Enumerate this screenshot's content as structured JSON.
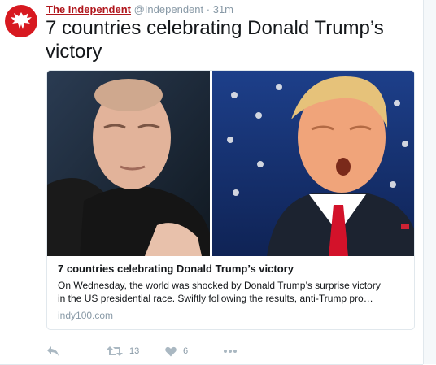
{
  "tweet": {
    "display_name": "The Independent",
    "handle": "@Independent",
    "separator": "·",
    "timestamp": "31m",
    "text": "7 countries celebrating Donald Trump’s victory"
  },
  "card": {
    "title": "7 countries celebrating Donald Trump’s victory",
    "description_line1": "On Wednesday, the world was shocked by Donald Trump’s surprise victory",
    "description_line2": "in the US presidential race. Swiftly following the results, anti-Trump pro…",
    "domain": "indy100.com"
  },
  "actions": {
    "reply_icon": "reply-icon",
    "retweet_icon": "retweet-icon",
    "retweet_count": "13",
    "like_icon": "heart-icon",
    "like_count": "6",
    "more_icon": "more-dots-icon"
  },
  "colors": {
    "brand_red": "#d71920",
    "name_red": "#b0161c",
    "meta_gray": "#8899a6",
    "icon_gray": "#aab8c2"
  }
}
